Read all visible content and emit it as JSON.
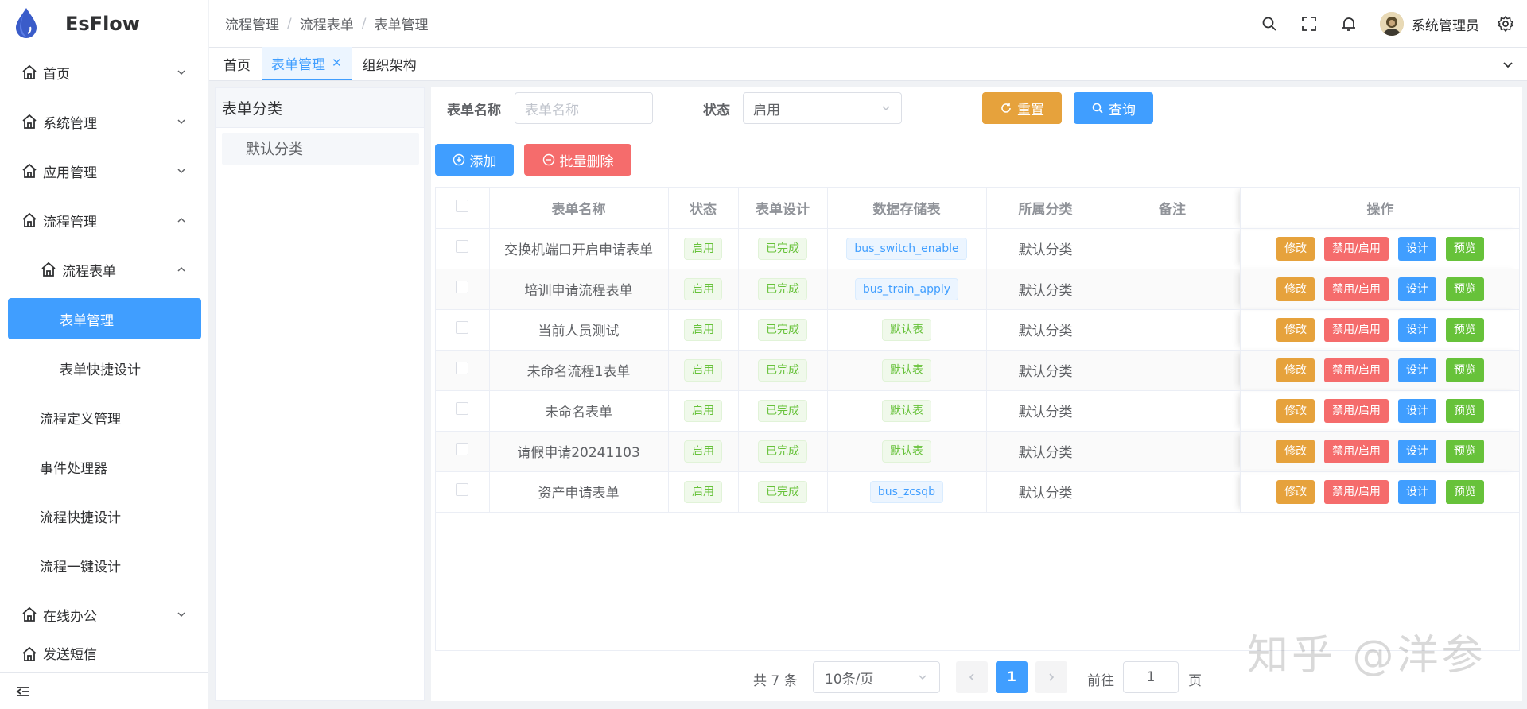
{
  "app": {
    "name": "EsFlow",
    "brand_color": "#409eff"
  },
  "sidebar": {
    "items": [
      {
        "label": "首页",
        "type": "group",
        "expanded": false
      },
      {
        "label": "系统管理",
        "type": "group",
        "expanded": false
      },
      {
        "label": "应用管理",
        "type": "group",
        "expanded": false
      },
      {
        "label": "流程管理",
        "type": "group",
        "expanded": true
      },
      {
        "label": "流程表单",
        "type": "subgroup",
        "expanded": true
      },
      {
        "label": "表单管理",
        "type": "leaf3",
        "active": true
      },
      {
        "label": "表单快捷设计",
        "type": "leaf3"
      },
      {
        "label": "流程定义管理",
        "type": "leaf"
      },
      {
        "label": "事件处理器",
        "type": "leaf"
      },
      {
        "label": "流程快捷设计",
        "type": "leaf"
      },
      {
        "label": "流程一键设计",
        "type": "leaf"
      },
      {
        "label": "在线办公",
        "type": "group",
        "expanded": false
      },
      {
        "label": "发送短信",
        "type": "group",
        "expanded": false
      }
    ]
  },
  "header": {
    "breadcrumb": [
      "流程管理",
      "流程表单",
      "表单管理"
    ],
    "username": "系统管理员"
  },
  "tabs": [
    {
      "label": "首页",
      "active": false
    },
    {
      "label": "表单管理",
      "active": true,
      "closable": true
    },
    {
      "label": "组织架构",
      "active": false
    }
  ],
  "category": {
    "title": "表单分类",
    "items": [
      "默认分类"
    ]
  },
  "search": {
    "name_label": "表单名称",
    "name_placeholder": "表单名称",
    "status_label": "状态",
    "status_value": "启用",
    "reset_label": "重置",
    "query_label": "查询"
  },
  "actions": {
    "add_label": "添加",
    "batch_delete_label": "批量删除"
  },
  "table": {
    "columns": [
      "表单名称",
      "状态",
      "表单设计",
      "数据存储表",
      "所属分类",
      "备注",
      "操作"
    ],
    "rows": [
      {
        "name": "交换机端口开启申请表单",
        "status": "启用",
        "design": "已完成",
        "storage": "bus_switch_enable",
        "storage_default": false,
        "category": "默认分类",
        "remark": ""
      },
      {
        "name": "培训申请流程表单",
        "status": "启用",
        "design": "已完成",
        "storage": "bus_train_apply",
        "storage_default": false,
        "category": "默认分类",
        "remark": ""
      },
      {
        "name": "当前人员测试",
        "status": "启用",
        "design": "已完成",
        "storage": "默认表",
        "storage_default": true,
        "category": "默认分类",
        "remark": ""
      },
      {
        "name": "未命名流程1表单",
        "status": "启用",
        "design": "已完成",
        "storage": "默认表",
        "storage_default": true,
        "category": "默认分类",
        "remark": ""
      },
      {
        "name": "未命名表单",
        "status": "启用",
        "design": "已完成",
        "storage": "默认表",
        "storage_default": true,
        "category": "默认分类",
        "remark": ""
      },
      {
        "name": "请假申请20241103",
        "status": "启用",
        "design": "已完成",
        "storage": "默认表",
        "storage_default": true,
        "category": "默认分类",
        "remark": ""
      },
      {
        "name": "资产申请表单",
        "status": "启用",
        "design": "已完成",
        "storage": "bus_zcsqb",
        "storage_default": false,
        "category": "默认分类",
        "remark": ""
      }
    ],
    "row_actions": {
      "edit": "修改",
      "toggle": "禁用/启用",
      "design": "设计",
      "preview": "预览"
    }
  },
  "pagination": {
    "total_text": "共 7 条",
    "page_size": "10条/页",
    "current_page": "1",
    "goto_label": "前往",
    "goto_value": "1",
    "page_suffix": "页"
  },
  "watermark": "知乎 @洋参"
}
